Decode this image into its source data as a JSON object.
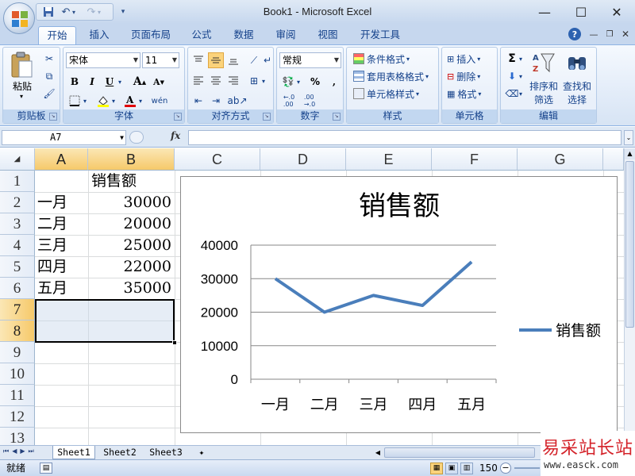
{
  "window": {
    "title": "Book1 - Microsoft Excel",
    "minimize": "—",
    "maximize": "☐",
    "close": "✕"
  },
  "tabs": [
    "开始",
    "插入",
    "页面布局",
    "公式",
    "数据",
    "审阅",
    "视图",
    "开发工具"
  ],
  "active_tab": "开始",
  "ribbon": {
    "clipboard": {
      "label": "剪贴板",
      "paste": "粘贴"
    },
    "font": {
      "label": "字体",
      "name": "宋体",
      "size": "11"
    },
    "alignment": {
      "label": "对齐方式"
    },
    "number": {
      "label": "数字",
      "format": "常规"
    },
    "styles": {
      "label": "样式",
      "conditional": "条件格式",
      "table": "套用表格格式",
      "cell": "单元格样式"
    },
    "cells": {
      "label": "单元格",
      "insert": "插入",
      "delete": "删除",
      "format": "格式"
    },
    "editing": {
      "label": "编辑",
      "sort": "排序和",
      "filter": "筛选",
      "find": "查找和",
      "select": "选择"
    }
  },
  "formula_bar": {
    "name_box": "A7",
    "fx": "fx",
    "value": ""
  },
  "columns": [
    "A",
    "B",
    "C",
    "D",
    "E",
    "F",
    "G"
  ],
  "rows": [
    "1",
    "2",
    "3",
    "4",
    "5",
    "6",
    "7",
    "8",
    "9",
    "10",
    "11",
    "12",
    "13"
  ],
  "cells": {
    "B1": "销售额",
    "A2": "一月",
    "B2": "30000",
    "A3": "二月",
    "B3": "20000",
    "A4": "三月",
    "B4": "25000",
    "A5": "四月",
    "B5": "22000",
    "A6": "五月",
    "B6": "35000"
  },
  "sheets": [
    "Sheet1",
    "Sheet2",
    "Sheet3"
  ],
  "active_sheet": "Sheet1",
  "status": {
    "ready": "就绪",
    "zoom": "150"
  },
  "watermark": {
    "brand": "易采站长站",
    "url": "www.easck.com"
  },
  "colors": {
    "series": "#4a7ebb",
    "accent": "#15428b",
    "selected_header": "#f6c96a"
  },
  "chart_data": {
    "type": "line",
    "title": "销售额",
    "categories": [
      "一月",
      "二月",
      "三月",
      "四月",
      "五月"
    ],
    "series": [
      {
        "name": "销售额",
        "values": [
          30000,
          20000,
          25000,
          22000,
          35000
        ]
      }
    ],
    "ylim": [
      0,
      40000
    ],
    "yticks": [
      "0",
      "10000",
      "20000",
      "30000",
      "40000"
    ],
    "grid": true,
    "legend": "right"
  }
}
